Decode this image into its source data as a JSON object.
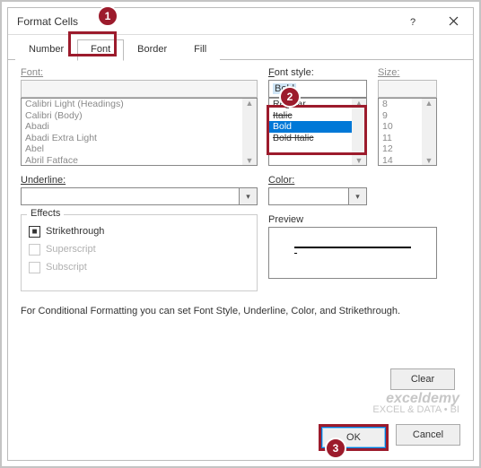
{
  "title": "Format Cells",
  "tabs": {
    "number": "Number",
    "font": "Font",
    "border": "Border",
    "fill": "Fill"
  },
  "font": {
    "label": "Font:",
    "value": "",
    "items": [
      "Calibri Light (Headings)",
      "Calibri (Body)",
      "Abadi",
      "Abadi Extra Light",
      "Abel",
      "Abril Fatface"
    ]
  },
  "style": {
    "label": "Font style:",
    "value": "Bold",
    "items": [
      "Regular",
      "Italic",
      "Bold",
      "Bold Italic"
    ]
  },
  "size": {
    "label": "Size:",
    "value": "",
    "items": [
      "8",
      "9",
      "10",
      "11",
      "12",
      "14"
    ]
  },
  "underline": {
    "label": "Underline:"
  },
  "color": {
    "label": "Color:"
  },
  "effects": {
    "label": "Effects",
    "strike": "Strikethrough",
    "sup": "Superscript",
    "sub": "Subscript"
  },
  "preview": {
    "label": "Preview"
  },
  "hint": "For Conditional Formatting you can set Font Style, Underline, Color, and Strikethrough.",
  "buttons": {
    "clear": "Clear",
    "ok": "OK",
    "cancel": "Cancel"
  },
  "watermark": {
    "brand": "exceldemy",
    "sub": "EXCEL & DATA • BI"
  },
  "badges": {
    "b1": "1",
    "b2": "2",
    "b3": "3"
  }
}
